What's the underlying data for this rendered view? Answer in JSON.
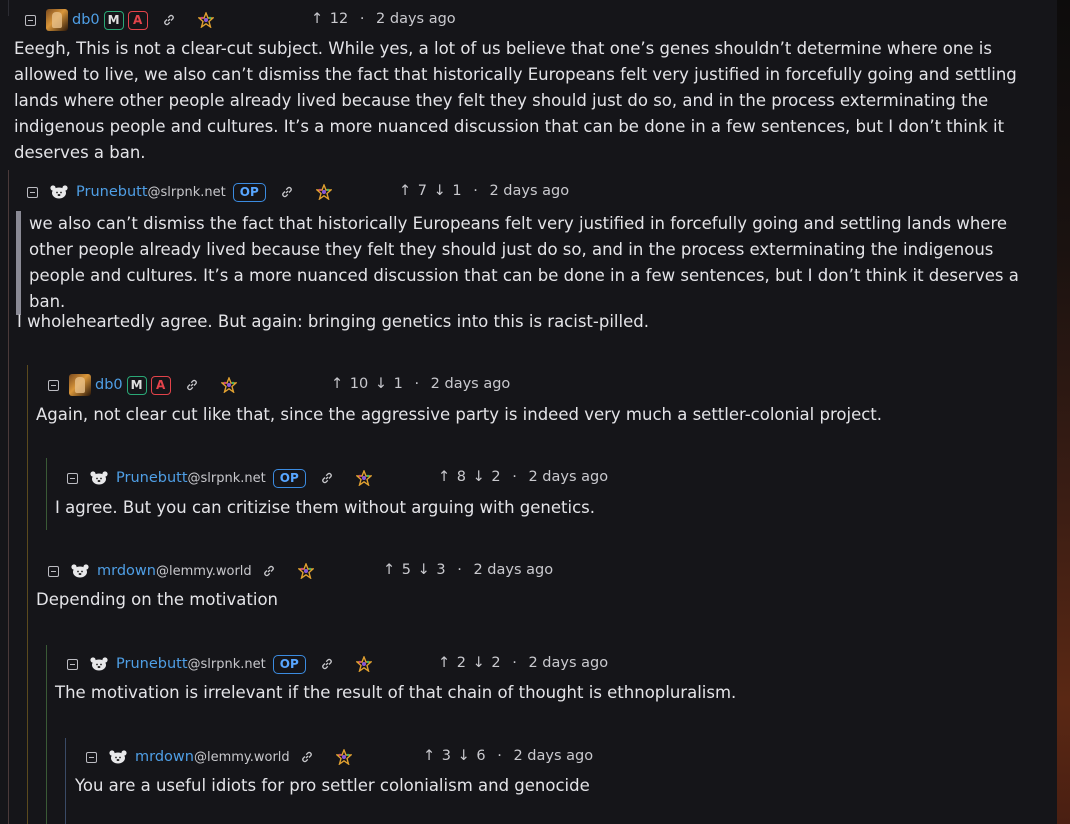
{
  "comments": [
    {
      "user": "db0",
      "instance": "",
      "badges": [
        "M",
        "A"
      ],
      "op": false,
      "up": "12",
      "down": "",
      "time": "2 days ago",
      "body": "Eeegh, This is not a clear-cut subject. While yes, a lot of us believe that one’s genes shouldn’t determine where one is allowed to live, we also can’t dismiss the fact that historically Europeans felt very justified in forcefully going and settling lands where other people already lived because they felt they should just do so, and in the process exterminating the indigenous people and cultures. It’s a more nuanced discussion that can be done in a few sentences, but I don’t think it deserves a ban."
    },
    {
      "user": "Prunebutt",
      "instance": "@slrpnk.net",
      "badges": [],
      "op": true,
      "op_label": "OP",
      "up": "7",
      "down": "1",
      "time": "2 days ago",
      "quote": "we also can’t dismiss the fact that historically Europeans felt very justified in forcefully going and settling lands where other people already lived because they felt they should just do so, and in the process exterminating the indigenous people and cultures. It’s a more nuanced discussion that can be done in a few sentences, but I don’t think it deserves a ban.",
      "body": "I wholeheartedly agree. But again: bringing genetics into this is racist-pilled."
    },
    {
      "user": "db0",
      "instance": "",
      "badges": [
        "M",
        "A"
      ],
      "op": false,
      "up": "10",
      "down": "1",
      "time": "2 days ago",
      "body": "Again, not clear cut like that, since the aggressive party is indeed very much a settler-colonial project."
    },
    {
      "user": "Prunebutt",
      "instance": "@slrpnk.net",
      "badges": [],
      "op": true,
      "op_label": "OP",
      "up": "8",
      "down": "2",
      "time": "2 days ago",
      "body": "I agree. But you can critizise them without arguing with genetics."
    },
    {
      "user": "mrdown",
      "instance": "@lemmy.world",
      "badges": [],
      "op": false,
      "up": "5",
      "down": "3",
      "time": "2 days ago",
      "body": "Depending on the motivation"
    },
    {
      "user": "Prunebutt",
      "instance": "@slrpnk.net",
      "badges": [],
      "op": true,
      "op_label": "OP",
      "up": "2",
      "down": "2",
      "time": "2 days ago",
      "body": "The motivation is irrelevant if the result of that chain of thought is ethnopluralism."
    },
    {
      "user": "mrdown",
      "instance": "@lemmy.world",
      "badges": [],
      "op": false,
      "up": "3",
      "down": "6",
      "time": "2 days ago",
      "body": "You are a useful idiots for pro settler colonialism and genocide"
    }
  ],
  "symbols": {
    "up_arrow": "↑",
    "down_arrow": "↓",
    "dot": "·"
  },
  "colors": {
    "thread_line_1": "#4b3a3a",
    "thread_line_2": "#5b4a1e",
    "thread_line_3": "#3a5a36",
    "username": "#4f9fe6",
    "mod_badge": "#2aa876",
    "admin_badge": "#e2434a",
    "op_badge": "#3b8be0"
  }
}
